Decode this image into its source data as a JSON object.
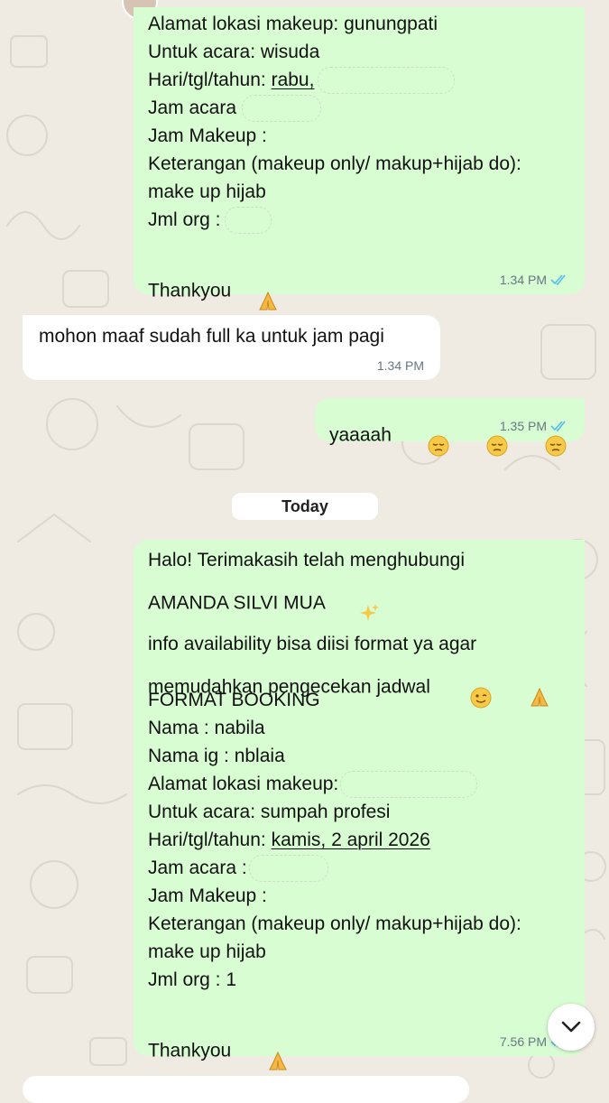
{
  "messages": [
    {
      "direction": "outgoing",
      "lines": {
        "l1": "Alamat lokasi makeup: gunungpati",
        "l2": "Untuk acara: wisuda",
        "l3_prefix": "Hari/tgl/tahun: ",
        "l3_value": "rabu,",
        "l4": "Jam acara",
        "l5": "Jam Makeup :",
        "l6": "Keterangan (makeup only/ makup+hijab do):",
        "l7": "make up hijab",
        "l8": "Jml org :",
        "l9": "Thankyou"
      },
      "time": "1.34 PM",
      "status": "read"
    },
    {
      "direction": "incoming",
      "text": "mohon maaf sudah full ka untuk jam pagi",
      "time": "1.34 PM"
    },
    {
      "direction": "outgoing",
      "text": "yaaaah",
      "time": "1.35 PM",
      "status": "read"
    },
    {
      "direction": "outgoing",
      "lines": {
        "l1": "Halo! Terimakasih telah menghubungi",
        "l2": "AMANDA SILVI MUA",
        "l3": "",
        "l4": "info availability bisa diisi format ya agar",
        "l5": "memudahkan pengecekan jadwal",
        "l6": "FORMAT BOOKING",
        "l7": "Nama : nabila",
        "l8": "Nama ig : nblaia",
        "l9": "Alamat lokasi makeup:",
        "l10": "Untuk acara: sumpah profesi",
        "l11_prefix": "Hari/tgl/tahun: ",
        "l11_value": "kamis, 2 april 2026",
        "l12": "Jam acara :",
        "l13": "Jam Makeup :",
        "l14": "Keterangan (makeup only/ makup+hijab do):",
        "l15": "make up hijab",
        "l16": "Jml org : 1",
        "l17": "",
        "l18": "Thankyou"
      },
      "time": "7.56 PM",
      "status": "read"
    }
  ],
  "date_separator": "Today",
  "colors": {
    "outgoing_bubble": "#d9fdd3",
    "incoming_bubble": "#ffffff",
    "background": "#efeae2",
    "read_ticks": "#53bdeb",
    "meta_text": "#667781"
  },
  "icons": [
    "pray-emoji",
    "pensive-emoji",
    "sparkles-emoji",
    "wink-emoji",
    "double-check-icon",
    "chevron-down-icon"
  ]
}
